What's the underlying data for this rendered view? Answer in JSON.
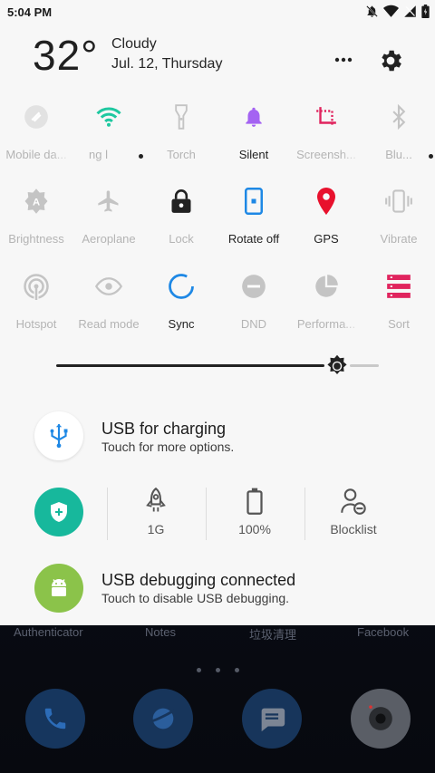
{
  "status_bar": {
    "time": "5:04 PM",
    "icons": [
      "dnd-off-icon",
      "wifi-icon",
      "no-signal-icon",
      "battery-icon"
    ]
  },
  "weather": {
    "temperature": "32°",
    "condition": "Cloudy",
    "date": "Jul. 12, Thursday"
  },
  "header_actions": {
    "more_icon": "more-icon",
    "settings_icon": "gear-icon"
  },
  "quick_tiles": [
    {
      "label": "Mobile da...",
      "icon": "mobile-data-icon",
      "active": false
    },
    {
      "label": "ng l",
      "icon": "wifi-icon",
      "active": false,
      "color": "#1ec8a0"
    },
    {
      "label": "Torch",
      "icon": "torch-icon",
      "active": false
    },
    {
      "label": "Silent",
      "icon": "bell-icon",
      "active": true,
      "color": "#a463f2"
    },
    {
      "label": "Screensh...",
      "icon": "screenshot-icon",
      "active": false,
      "color": "#e0245e"
    },
    {
      "label": "Blu...",
      "icon": "bluetooth-icon",
      "active": false
    },
    {
      "label": "Brightness",
      "icon": "auto-brightness-icon",
      "active": false
    },
    {
      "label": "Aeroplane",
      "icon": "aeroplane-icon",
      "active": false
    },
    {
      "label": "Lock",
      "icon": "lock-icon",
      "active": false
    },
    {
      "label": "Rotate off",
      "icon": "rotate-icon",
      "active": true,
      "color": "#1e88e5"
    },
    {
      "label": "GPS",
      "icon": "location-icon",
      "active": true,
      "color": "#e8112d"
    },
    {
      "label": "Vibrate",
      "icon": "vibrate-icon",
      "active": false
    },
    {
      "label": "Hotspot",
      "icon": "hotspot-icon",
      "active": false
    },
    {
      "label": "Read mode",
      "icon": "eye-icon",
      "active": false
    },
    {
      "label": "Sync",
      "icon": "sync-icon",
      "active": true,
      "color": "#1e88e5"
    },
    {
      "label": "DND",
      "icon": "dnd-icon",
      "active": false
    },
    {
      "label": "Performa...",
      "icon": "performance-icon",
      "active": false
    },
    {
      "label": "Sort",
      "icon": "sort-icon",
      "active": false,
      "color": "#e0245e"
    }
  ],
  "brightness": {
    "level": 0.87
  },
  "usb_notification": {
    "title": "USB for charging",
    "subtitle": "Touch for more options.",
    "icon": "usb-icon"
  },
  "tools": {
    "shield_icon": "shield-plus-icon",
    "items": [
      {
        "label": "1G",
        "icon": "rocket-icon"
      },
      {
        "label": "100%",
        "icon": "battery-outline-icon"
      },
      {
        "label": "Blocklist",
        "icon": "person-block-icon"
      }
    ]
  },
  "debug_notification": {
    "title": "USB debugging connected",
    "subtitle": "Touch to disable USB debugging.",
    "icon": "android-icon"
  },
  "home": {
    "app_labels": [
      "Authenticator",
      "Notes",
      "垃圾清理",
      "Facebook"
    ],
    "dock": [
      "phone-icon",
      "browser-icon",
      "messages-icon",
      "camera-icon"
    ]
  },
  "colors": {
    "accent_teal": "#17b89c",
    "accent_green": "#8bc34a",
    "shade_bg": "#f7f7f7"
  }
}
